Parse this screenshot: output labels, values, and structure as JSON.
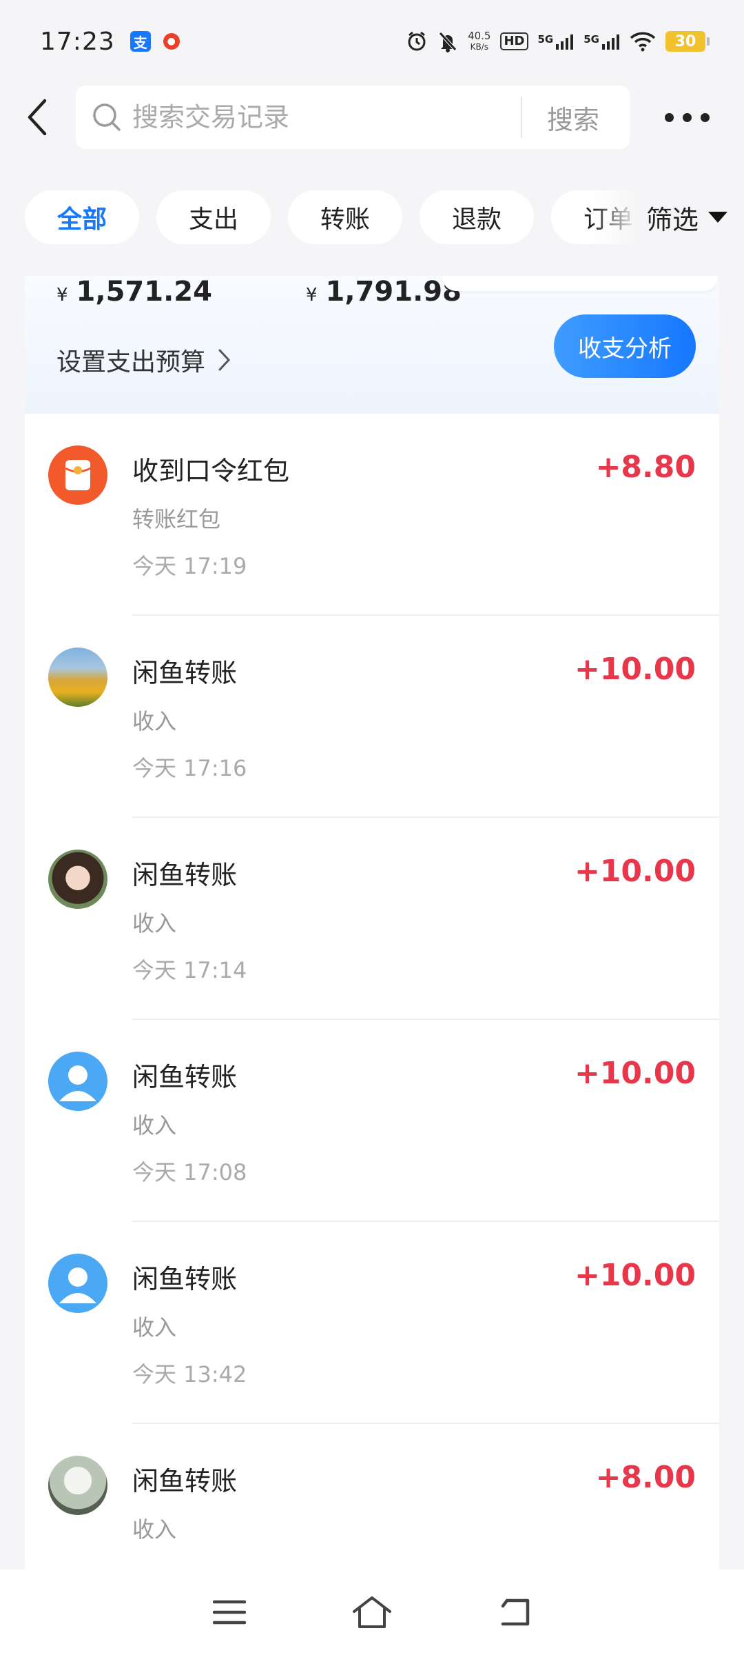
{
  "status_bar": {
    "time": "17:23",
    "net_speed_value": "40.5",
    "net_speed_unit": "KB/s",
    "hd_label": "HD",
    "signal1_label": "5G",
    "signal2_label": "5G",
    "battery": "30"
  },
  "search": {
    "placeholder": "搜索交易记录",
    "button_label": "搜索"
  },
  "tabs": [
    {
      "label": "全部",
      "active": true
    },
    {
      "label": "支出"
    },
    {
      "label": "转账"
    },
    {
      "label": "退款"
    },
    {
      "label": "订单"
    }
  ],
  "filter": {
    "label": "筛选"
  },
  "summary": {
    "currency": "¥",
    "expense_amount": "1,571.24",
    "income_amount": "1,791.98",
    "budget_link": "设置支出预算",
    "analysis_button": "收支分析"
  },
  "transactions": [
    {
      "title": "收到口令红包",
      "subtitle": "转账红包",
      "time": "今天 17:19",
      "amount": "+8.80",
      "avatar": "red-packet"
    },
    {
      "title": "闲鱼转账",
      "subtitle": "收入",
      "time": "今天 17:16",
      "amount": "+10.00",
      "avatar": "flowers-photo"
    },
    {
      "title": "闲鱼转账",
      "subtitle": "收入",
      "time": "今天 17:14",
      "amount": "+10.00",
      "avatar": "girl-photo"
    },
    {
      "title": "闲鱼转账",
      "subtitle": "收入",
      "time": "今天 17:08",
      "amount": "+10.00",
      "avatar": "default-person"
    },
    {
      "title": "闲鱼转账",
      "subtitle": "收入",
      "time": "今天 13:42",
      "amount": "+10.00",
      "avatar": "default-person"
    },
    {
      "title": "闲鱼转账",
      "subtitle": "收入",
      "time": "",
      "amount": "+8.00",
      "avatar": "cloud-photo"
    }
  ],
  "colors": {
    "accent": "#1677ff",
    "income": "#e8364a",
    "background": "#f5f5f7"
  }
}
